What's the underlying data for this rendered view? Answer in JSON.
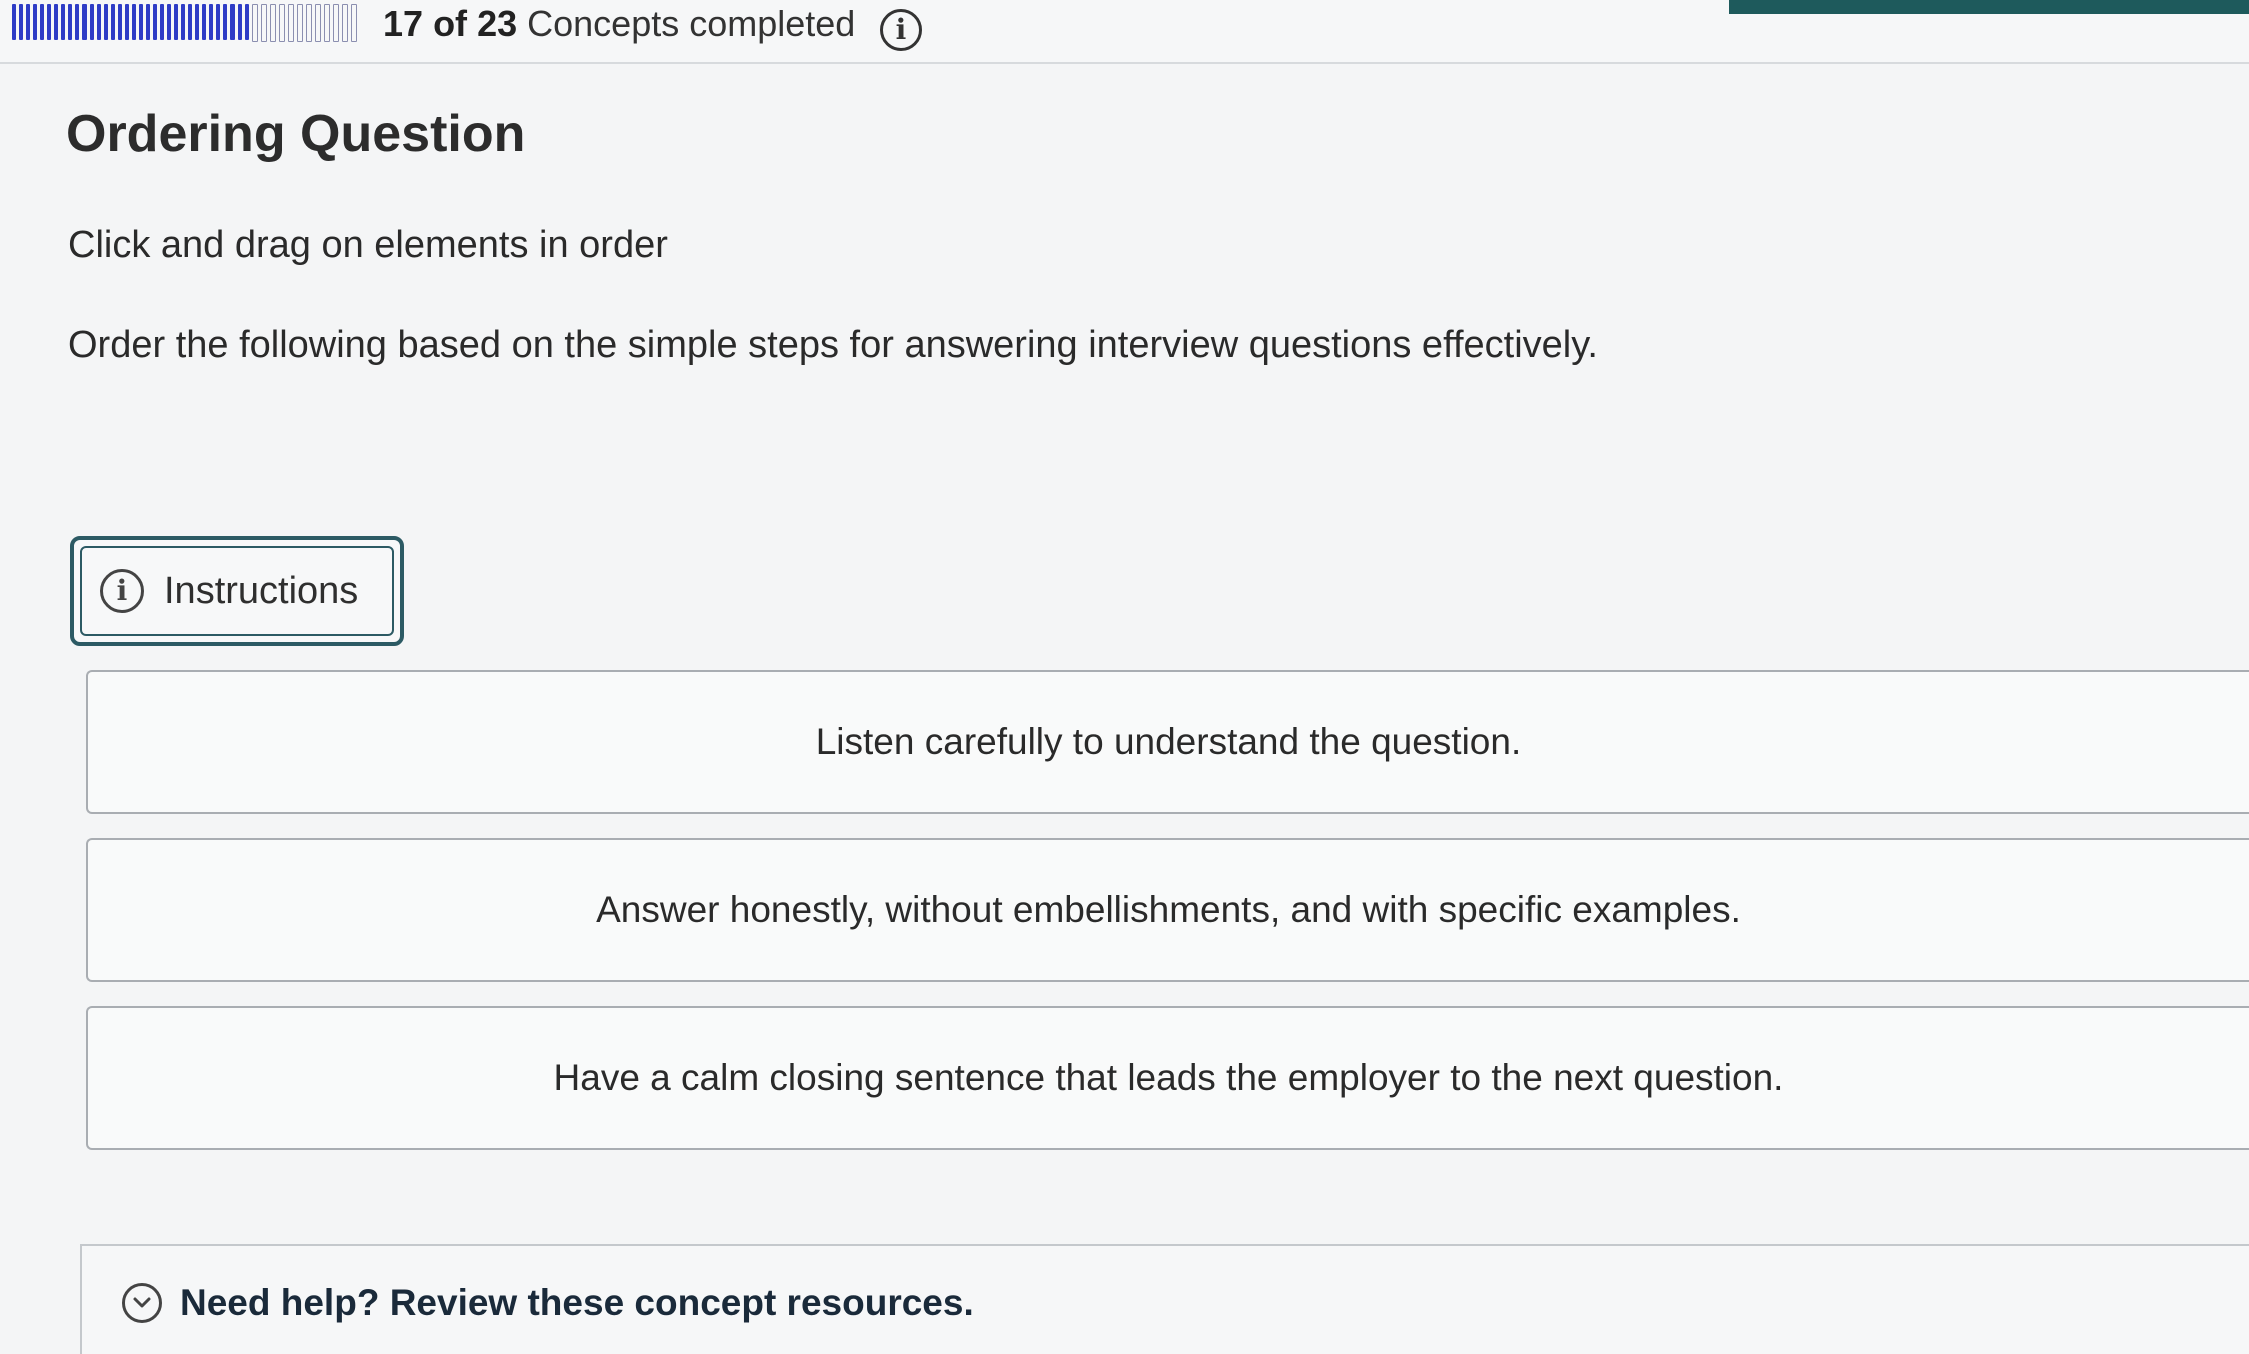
{
  "progress": {
    "completed": "17",
    "of_label": "of",
    "total": "23",
    "suffix": "Concepts completed",
    "fraction": 0.739
  },
  "question": {
    "title": "Ordering Question",
    "directions": "Click and drag on elements in order",
    "prompt": "Order the following based on the simple steps for answering interview questions effectively."
  },
  "instructions": {
    "label": "Instructions"
  },
  "items": [
    {
      "text": "Listen carefully to understand the question."
    },
    {
      "text": "Answer honestly, without embellishments, and with specific examples."
    },
    {
      "text": "Have a calm closing sentence that leads the employer to the next question."
    }
  ],
  "help": {
    "label": "Need help? Review these concept resources."
  },
  "icons": {
    "progress_info": "info-icon",
    "instructions": "info-icon",
    "help_toggle": "chevron-down-icon"
  },
  "colors": {
    "progress_fill": "#2e3cc6",
    "button_border": "#2c5a64",
    "accent": "#1e5a5c"
  }
}
